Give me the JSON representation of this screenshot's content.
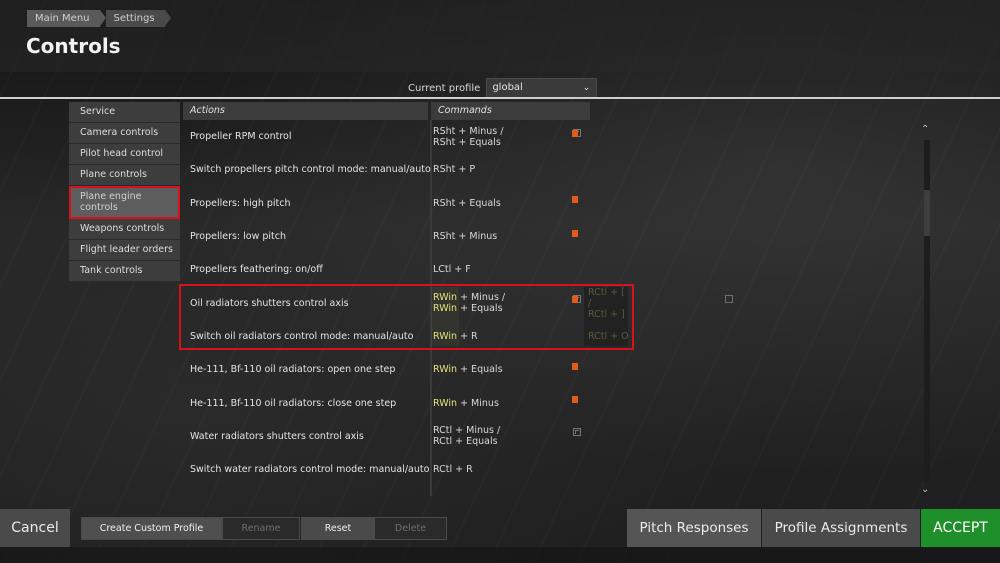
{
  "header": {
    "breadcrumb": [
      "Main Menu",
      "Settings"
    ],
    "title": "Controls"
  },
  "profile": {
    "label": "Current profile",
    "value": "global"
  },
  "menu": [
    {
      "label": "Service"
    },
    {
      "label": "Camera controls"
    },
    {
      "label": "Pilot head control"
    },
    {
      "label": "Plane controls"
    },
    {
      "label": "Plane engine controls",
      "line1": "Plane engine",
      "line2": "controls",
      "active": true
    },
    {
      "label": "Weapons controls"
    },
    {
      "label": "Flight leader orders"
    },
    {
      "label": "Tank controls"
    }
  ],
  "table": {
    "col_actions": "Actions",
    "col_commands": "Commands",
    "rows": [
      {
        "action": "Propeller RPM control",
        "cmd_line1": "RSht + Minus /",
        "cmd_line2": "RSht + Equals",
        "cmd2_line1": "",
        "cmd2_line2": ""
      },
      {
        "action": "Switch propellers pitch control mode: manual/auto",
        "cmd_line1": "RSht + P",
        "cmd_line2": "",
        "cmd2_line1": "",
        "cmd2_line2": ""
      },
      {
        "action": "Propellers: high pitch",
        "cmd_line1": "RSht + Equals",
        "cmd_line2": "",
        "cmd2_line1": "",
        "cmd2_line2": ""
      },
      {
        "action": "Propellers: low pitch",
        "cmd_line1": "RSht + Minus",
        "cmd_line2": "",
        "cmd2_line1": "",
        "cmd2_line2": ""
      },
      {
        "action": "Propellers feathering: on/off",
        "cmd_line1": "LCtl + F",
        "cmd_line2": "",
        "cmd2_line1": "",
        "cmd2_line2": ""
      },
      {
        "action": "Oil radiators shutters control axis",
        "cmd_line1": "RWin + Minus /",
        "cmd_line2": "RWin + Equals",
        "cmd2_line1": "RCtl + [ /",
        "cmd2_line2": "RCtl + ]"
      },
      {
        "action": "Switch oil radiators control mode: manual/auto",
        "cmd_line1": "RWin + R",
        "cmd_line2": "",
        "cmd2_line1": "RCtl + O",
        "cmd2_line2": ""
      },
      {
        "action": "He-111, Bf-110 oil radiators: open one step",
        "cmd_line1": "RWin + Equals",
        "cmd_line2": "",
        "cmd2_line1": "",
        "cmd2_line2": ""
      },
      {
        "action": "He-111, Bf-110 oil radiators: close one step",
        "cmd_line1": "RWin + Minus",
        "cmd_line2": "",
        "cmd2_line1": "",
        "cmd2_line2": ""
      },
      {
        "action": "Water radiators shutters control axis",
        "cmd_line1": "RCtl + Minus /",
        "cmd_line2": "RCtl + Equals",
        "cmd2_line1": "",
        "cmd2_line2": ""
      },
      {
        "action": "Switch water radiators control mode: manual/auto",
        "cmd_line1": "RCtl + R",
        "cmd_line2": "",
        "cmd2_line1": "",
        "cmd2_line2": ""
      }
    ]
  },
  "footer": {
    "cancel": "Cancel",
    "create_profile": "Create Custom Profile",
    "rename": "Rename",
    "reset": "Reset",
    "delete": "Delete",
    "pitch_responses": "Pitch Responses",
    "profile_assignments": "Profile Assignments",
    "accept": "ACCEPT"
  },
  "colors": {
    "accent_green": "#1f8f2a",
    "highlight_red": "#d8121d",
    "binding_yellow": "#e3e07a",
    "delete_orange": "#e25a1c"
  }
}
